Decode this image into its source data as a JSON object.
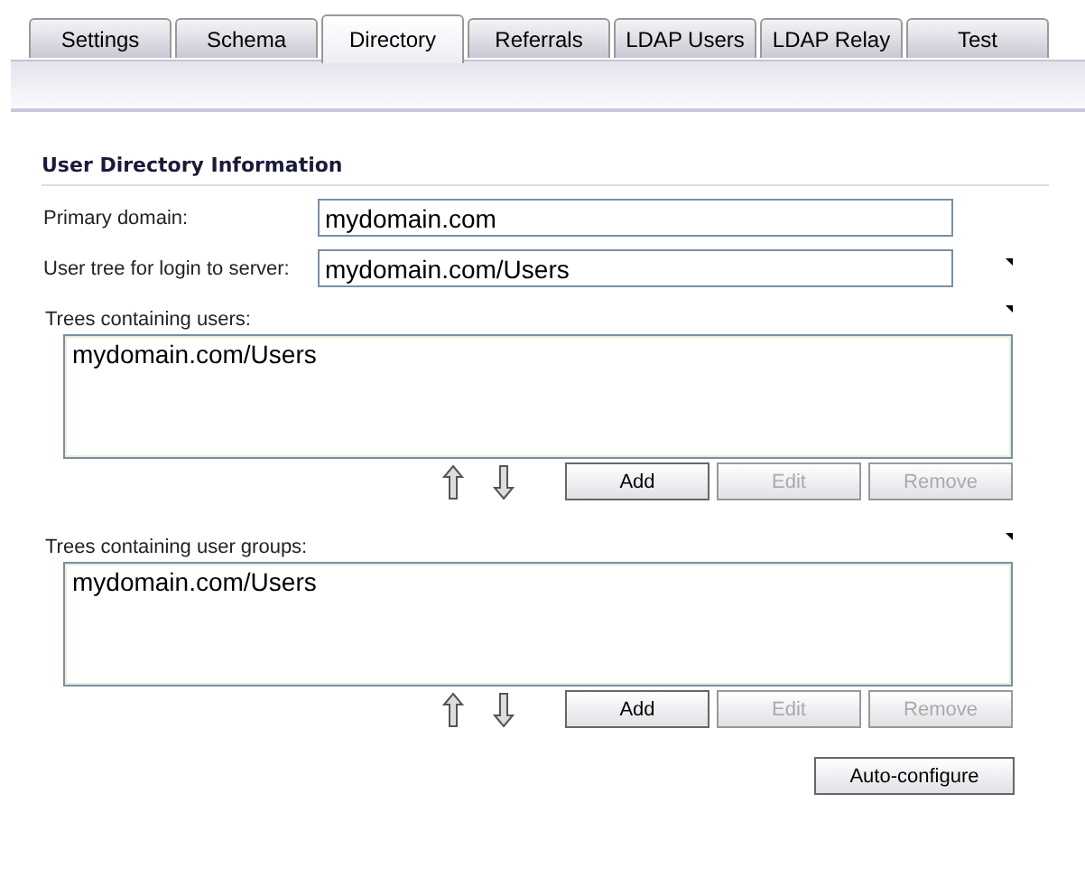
{
  "tabs": [
    {
      "label": "Settings",
      "selected": false
    },
    {
      "label": "Schema",
      "selected": false
    },
    {
      "label": "Directory",
      "selected": true
    },
    {
      "label": "Referrals",
      "selected": false
    },
    {
      "label": "LDAP Users",
      "selected": false
    },
    {
      "label": "LDAP Relay",
      "selected": false
    },
    {
      "label": "Test",
      "selected": false
    }
  ],
  "section_title": "User Directory Information",
  "fields": [
    {
      "label": "Primary domain:",
      "value": "mydomain.com"
    },
    {
      "label": "User tree for login to server:",
      "value": "mydomain.com/Users"
    }
  ],
  "lists": [
    {
      "label": "Trees containing users:",
      "items": [
        "mydomain.com/Users"
      ],
      "buttons": [
        {
          "label": "Add",
          "disabled": false
        },
        {
          "label": "Edit",
          "disabled": true
        },
        {
          "label": "Remove",
          "disabled": true
        }
      ]
    },
    {
      "label": "Trees containing user groups:",
      "items": [
        "mydomain.com/Users"
      ],
      "buttons": [
        {
          "label": "Add",
          "disabled": false
        },
        {
          "label": "Edit",
          "disabled": true
        },
        {
          "label": "Remove",
          "disabled": true
        }
      ]
    }
  ],
  "auto_configure_button": "Auto-configure"
}
